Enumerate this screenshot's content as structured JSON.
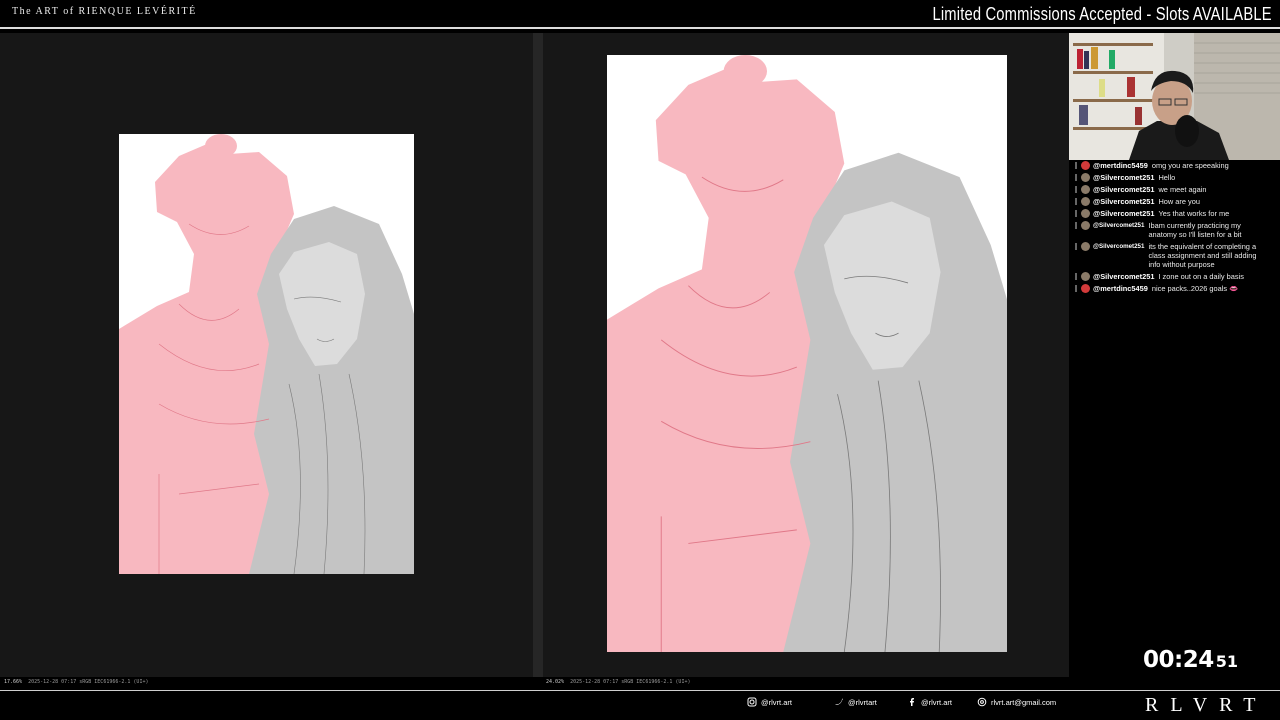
{
  "header": {
    "brand": "The ART of RIENQUE LEVÉRITÉ",
    "announcement": "Limited Commissions Accepted - Slots AVAILABLE"
  },
  "panels": {
    "left": {
      "zoom": "17.66%",
      "status": "2025-12-28 07:17 sRGB IEC61966-2.1 (UI+)"
    },
    "right": {
      "zoom": "24.02%",
      "status": "2025-12-28 07:17 sRGB IEC61966-2.1 (UI+)"
    }
  },
  "colors": {
    "sketch_pink": "#f8b8c0",
    "sketch_gray": "#bdbdbd",
    "canvas_bg": "#ffffff",
    "panel_bg": "#171717"
  },
  "chat": {
    "messages": [
      {
        "user": "@mertdinc5459",
        "text": "omg you are speeaking",
        "avatar_color": "#d23a3a"
      },
      {
        "user": "@Silvercomet251",
        "text": "Hello",
        "avatar_color": "#8a7a68"
      },
      {
        "user": "@Silvercomet251",
        "text": "we meet again",
        "avatar_color": "#8a7a68"
      },
      {
        "user": "@Silvercomet251",
        "text": "How are you",
        "avatar_color": "#8a7a68"
      },
      {
        "user": "@Silvercomet251",
        "text": "Yes that works for me",
        "avatar_color": "#8a7a68"
      },
      {
        "user": "@Silvercomet251",
        "text": "Ibam currently practicing my anatomy so I'll listen for a bit",
        "avatar_color": "#8a7a68"
      },
      {
        "user": "@Silvercomet251",
        "text": "its the equivalent of completing a class assignment and still adding info without purpose",
        "avatar_color": "#8a7a68"
      },
      {
        "user": "@Silvercomet251",
        "text": "I zone out on a daily basis",
        "avatar_color": "#8a7a68"
      },
      {
        "user": "@mertdinc5459",
        "text": "nice packs..2026 goals 👄",
        "avatar_color": "#d23a3a"
      }
    ]
  },
  "timer": {
    "main": "00:24",
    "seconds": "51"
  },
  "footer": {
    "instagram": "@rlvrt.art",
    "twitter": "@rlvrtart",
    "facebook": "@rlvrt.art",
    "email": "rlvrt.art@gmail.com",
    "logo": "RLVRT"
  }
}
